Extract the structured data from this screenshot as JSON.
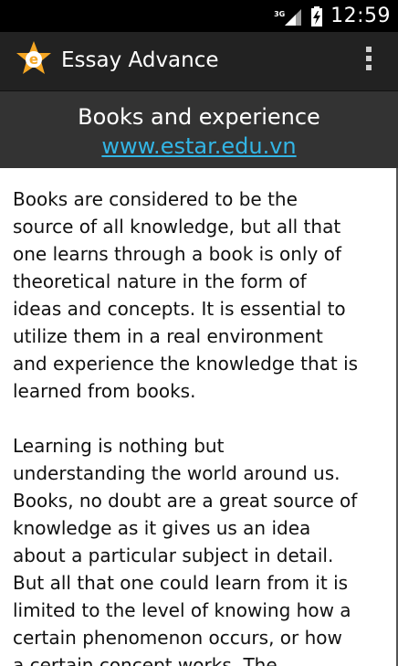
{
  "status_bar": {
    "network": "3G",
    "time": "12:59"
  },
  "action_bar": {
    "title": "Essay Advance",
    "icon": "app-logo-e-star",
    "overflow_icon": "overflow-menu-icon"
  },
  "header": {
    "title": "Books and experience",
    "link": "www.estar.edu.vn"
  },
  "content": {
    "paragraphs": [
      "Books are considered to be the\nsource of all knowledge, but all that\none learns through a book is only of\ntheoretical nature in the form of\nideas and concepts. It is essential to\nutilize them in a real environment\nand experience the knowledge that is\nlearned from books.",
      "Learning is nothing but\nunderstanding  the world around us.\nBooks, no doubt are a great source of\nknowledge as it gives us an idea\nabout a particular subject in detail.\nBut all that one could learn from it is\nlimited to the level of knowing how a\ncertain phenomenon occurs, or how\na certain concept works. The"
    ]
  },
  "colors": {
    "status_bar_bg": "#000000",
    "action_bar_bg": "#222222",
    "header_bg": "#333333",
    "link": "#33b5e5",
    "logo_star": "#f5a623"
  }
}
